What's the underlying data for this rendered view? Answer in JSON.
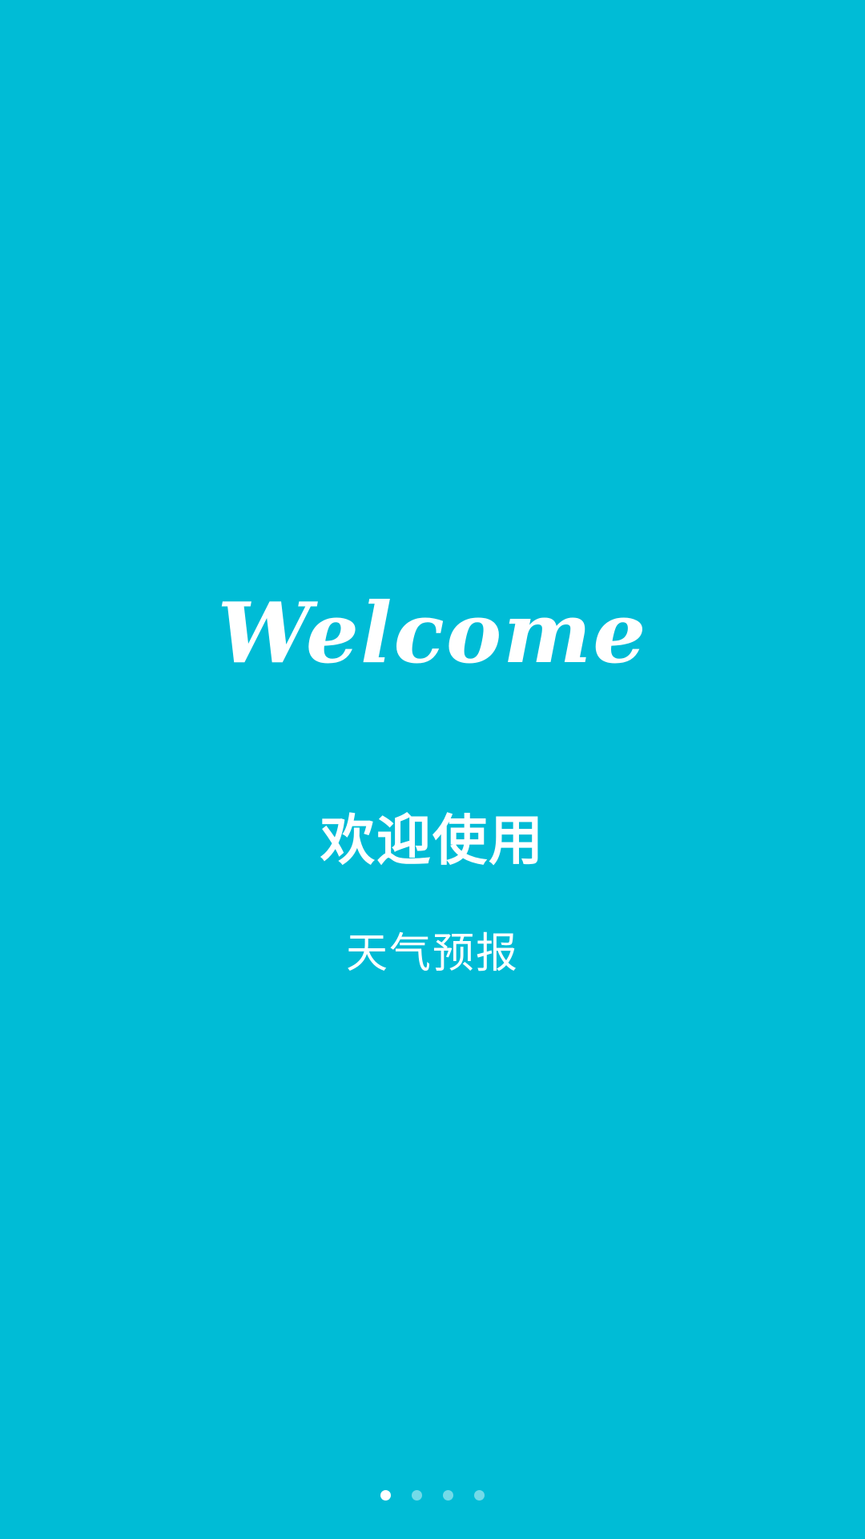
{
  "colors": {
    "background": "#00BCD6",
    "text": "#FFFFFF",
    "dot_active": "#FFFFFF",
    "dot_inactive": "rgba(255,255,255,0.45)"
  },
  "splash": {
    "logo_text": "Welcome",
    "title": "欢迎使用",
    "subtitle": "天气预报"
  },
  "pager": {
    "total_pages": 4,
    "active_index": 0
  }
}
